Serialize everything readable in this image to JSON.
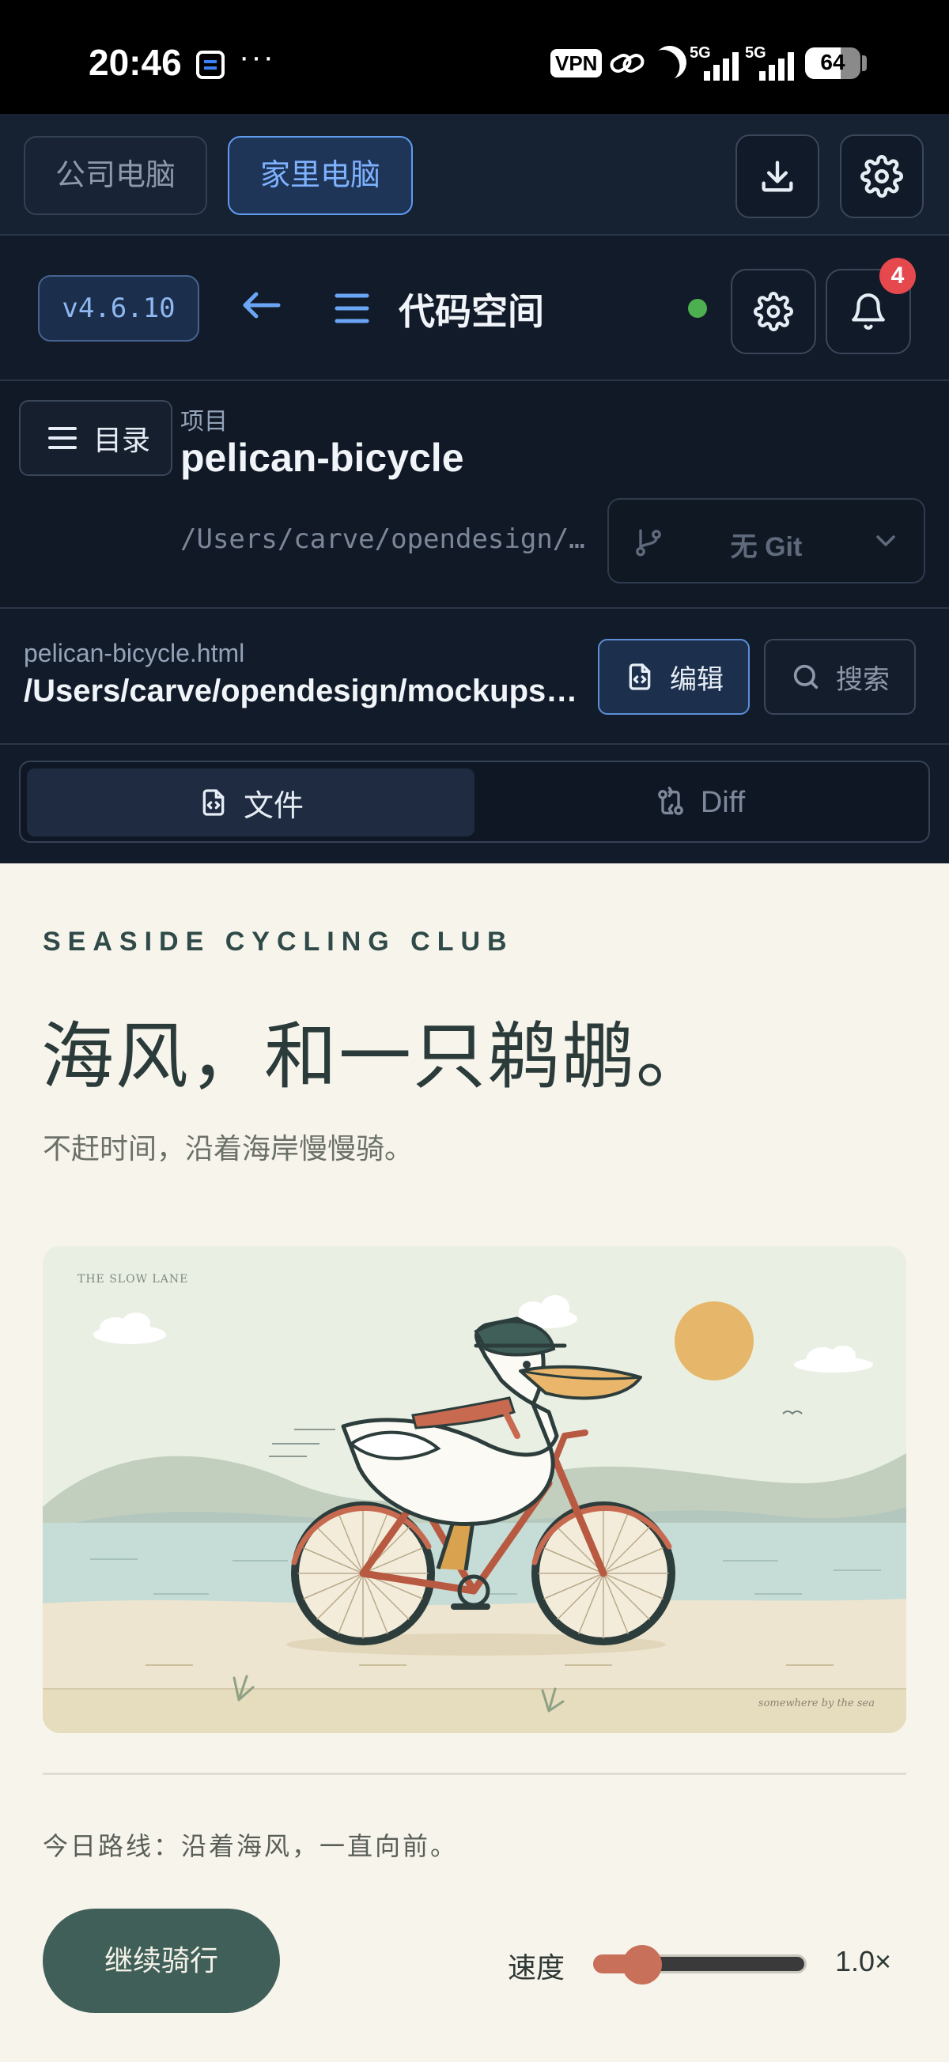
{
  "status_bar": {
    "time": "20:46",
    "dots": "···",
    "vpn": "VPN",
    "signal_1": "5G",
    "signal_2": "5G",
    "battery": "64"
  },
  "machines": {
    "tabs": [
      {
        "label": "公司电脑",
        "active": false
      },
      {
        "label": "家里电脑",
        "active": true
      }
    ]
  },
  "header": {
    "version": "v4.6.10",
    "title": "代码空间",
    "notification_count": "4",
    "status_color": "#4caf50"
  },
  "project": {
    "toc_label": "目录",
    "label": "项目",
    "name": "pelican-bicycle",
    "path": "/Users/carve/opendesign/mockups/pelican-bicycle",
    "git_label": "无 Git"
  },
  "file": {
    "name": "pelican-bicycle.html",
    "path": "/Users/carve/opendesign/mockups/pelican-bicycle.html",
    "edit_label": "编辑",
    "search_label": "搜索"
  },
  "view_tabs": [
    {
      "label": "文件",
      "active": true
    },
    {
      "label": "Diff",
      "active": false
    }
  ],
  "preview": {
    "eyebrow": "SEASIDE CYCLING CLUB",
    "headline": "海风，和一只鹈鹕。",
    "subline": "不赶时间，沿着海岸慢慢骑。",
    "illustration_caption": "THE SLOW LANE",
    "illustration_signature": "somewhere by the sea",
    "route": "今日路线：沿着海风，一直向前。",
    "continue_label": "继续骑行",
    "speed_label": "速度",
    "speed_value": "1.0×",
    "speed_fraction": 0.23
  },
  "colors": {
    "accent": "#5f9cef",
    "brand_green": "#3f5f58",
    "slider": "#c9705a",
    "badge": "#e5484d"
  }
}
